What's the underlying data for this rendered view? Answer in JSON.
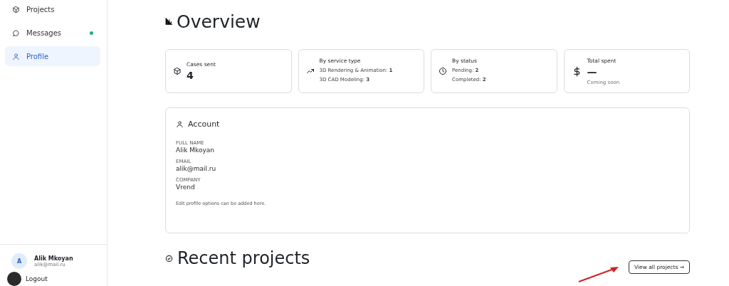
{
  "sidebar": {
    "items": [
      {
        "label": "Projects",
        "selected": false,
        "dot": false
      },
      {
        "label": "Messages",
        "selected": false,
        "dot": true
      },
      {
        "label": "Profile",
        "selected": true,
        "dot": false
      }
    ],
    "user": {
      "initial": "A",
      "name": "Alik Mkoyan",
      "email": "alik@mail.ru"
    },
    "logout": "Logout"
  },
  "overview": {
    "title": "Overview",
    "stats": [
      {
        "title": "Cases sent",
        "value": "4"
      },
      {
        "title": "By service type",
        "lines": [
          "3D Rendering & Animation: **1**",
          "3D CAD Modeling: **3**"
        ]
      },
      {
        "title": "By status",
        "lines": [
          "Pending: **2**",
          "Completed: **2**"
        ]
      },
      {
        "title": "Total spent",
        "value": "—",
        "note": "Coming soon"
      }
    ]
  },
  "account": {
    "title": "Account",
    "fields": [
      {
        "label": "FULL NAME",
        "value": "Alik Mkoyan"
      },
      {
        "label": "EMAIL",
        "value": "alik@mail.ru"
      },
      {
        "label": "COMPANY",
        "value": "Vrend"
      }
    ],
    "note": "Edit profile options can be added here."
  },
  "recent": {
    "title": "Recent projects",
    "button": "View all projects →"
  }
}
